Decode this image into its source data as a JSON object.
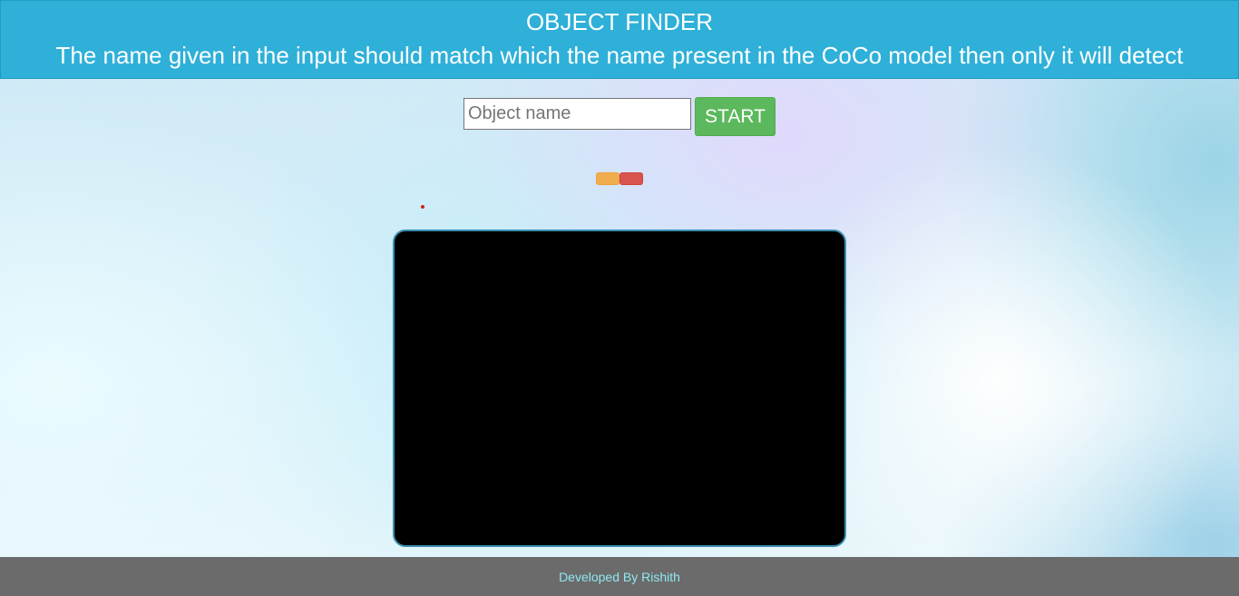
{
  "header": {
    "title": "OBJECT FINDER",
    "subtitle": "The name given in the input should match which the name present in the CoCo model then only it will detect"
  },
  "controls": {
    "input_placeholder": "Object name",
    "input_value": "",
    "start_label": "START"
  },
  "colors": {
    "header_bg": "#2eb0d8",
    "start_button": "#5cb85c",
    "indicator_yellow": "#f0ad4e",
    "indicator_red": "#d9534f",
    "video_bg": "#000000",
    "footer_bg": "#6b6b6b",
    "footer_text": "#8ee8f2"
  },
  "footer": {
    "credit": "Developed By Rishith"
  }
}
